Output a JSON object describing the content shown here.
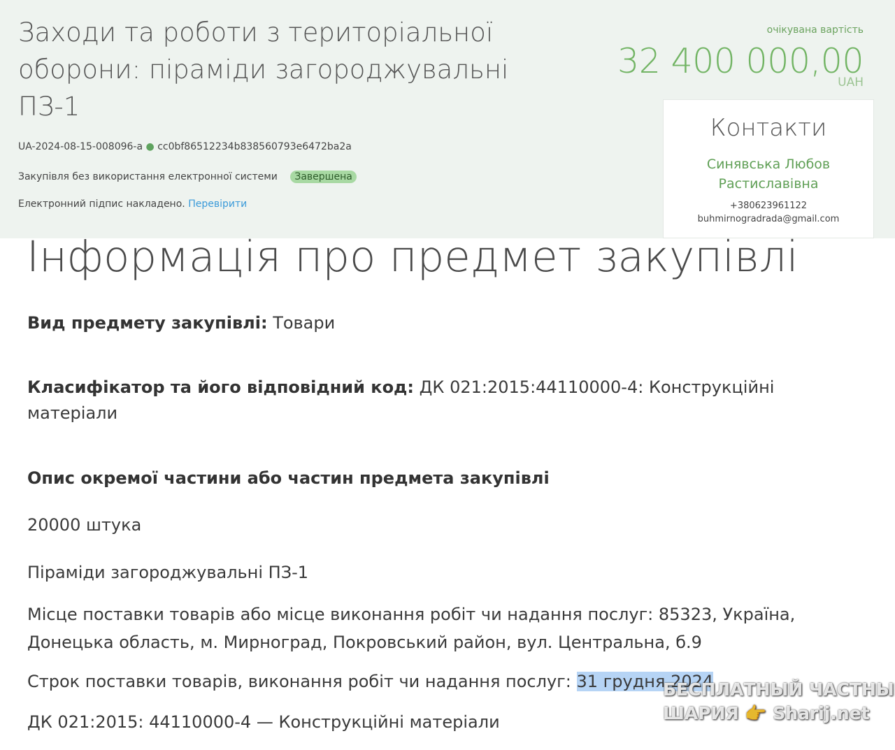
{
  "header": {
    "title": "Заходи та роботи з територіальної оборони: піраміди загороджувальні ПЗ-1",
    "tender_id": "UA-2024-08-15-008096-a",
    "hash": "cc0bf86512234b838560793e6472ba2a",
    "method": "Закупівля без використання електронної системи",
    "status": "Завершена",
    "signature_text": "Електронний підпис накладено.",
    "verify_link": "Перевірити",
    "expected_cost_label": "очікувана вартість",
    "expected_cost_value": "32 400 000,00",
    "currency": "UAH",
    "dot": "●"
  },
  "contacts": {
    "title": "Контакти",
    "name": "Синявська Любов Растиславівна",
    "phone": "+380623961122",
    "email": "buhmirnogradrada@gmail.com"
  },
  "info": {
    "section_title": "Інформація про предмет закупівлі",
    "type_label": "Вид предмету закупівлі:",
    "type_value": "Товари",
    "classifier_label": "Класифікатор та його відповідний код:",
    "classifier_value": "ДК 021:2015:44110000-4: Конструкційні матеріали",
    "description_heading": "Опис окремої частини або частин предмета закупівлі",
    "quantity": "20000 штука",
    "item_name": "Піраміди загороджувальні ПЗ-1",
    "delivery_place": "Місце поставки товарів або місце виконання робіт чи надання послуг: 85323, Україна, Донецька область, м. Мирноград, Покровський район, вул. Центральна, б.9",
    "delivery_term_label": "Строк поставки товарів, виконання робіт чи надання послуг:",
    "delivery_term_value": "31 грудня 2024",
    "cpv": "ДК 021:2015: 44110000-4 — Конструкційні матеріали"
  },
  "watermark": {
    "line1": "БЕСПЛАТНЫЙ ЧАСТНЫЙ",
    "line2": "ШАРИЯ 👉 Sharij.net"
  }
}
